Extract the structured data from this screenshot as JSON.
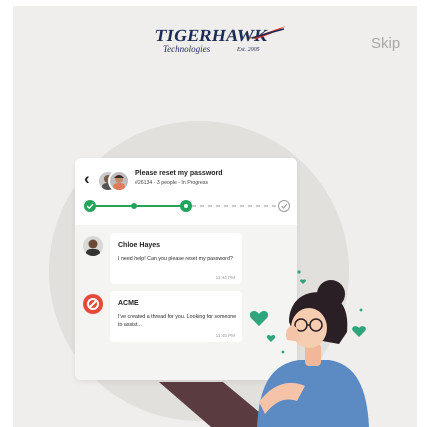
{
  "header": {
    "logo": {
      "wordmark": "TIGERHAWK",
      "tagline": "Technologies",
      "established": "Est. 2005"
    },
    "skip_label": "Skip"
  },
  "ticket": {
    "title": "Please reset my password",
    "meta": "#26134 - 3 people - In Progress",
    "progress_steps_completed": 3,
    "progress_steps_total": 4
  },
  "messages": [
    {
      "sender": "Chloe Hayes",
      "text": "I need help! Can you please reset my password?",
      "time": "11:44 PM"
    },
    {
      "sender": "ACME",
      "text": "I've created a thread for you. Looking for someone to assist...",
      "time": "11:45 PM"
    }
  ],
  "colors": {
    "background": "#efeeec",
    "circle": "#e1e0dd",
    "accent_green": "#24a45b",
    "heart": "#2fa57d",
    "acme_red": "#e54a3a",
    "skip_text": "#a9a7a3"
  }
}
